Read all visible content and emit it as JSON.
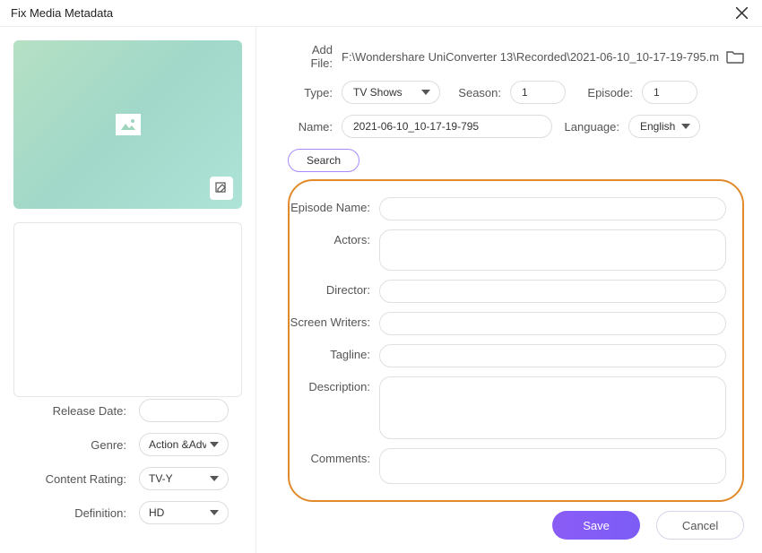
{
  "window": {
    "title": "Fix Media Metadata"
  },
  "left": {
    "releaseDateLabel": "Release Date:",
    "releaseDateValue": "",
    "genreLabel": "Genre:",
    "genreValue": "Action &Adv",
    "contentRatingLabel": "Content Rating:",
    "contentRatingValue": "TV-Y",
    "definitionLabel": "Definition:",
    "definitionValue": "HD"
  },
  "right": {
    "addFileLabel": "Add File:",
    "addFilePath": "F:\\Wondershare UniConverter 13\\Recorded\\2021-06-10_10-17-19-795.m",
    "typeLabel": "Type:",
    "typeValue": "TV Shows",
    "seasonLabel": "Season:",
    "seasonValue": "1",
    "episodeLabel": "Episode:",
    "episodeValue": "1",
    "nameLabel": "Name:",
    "nameValue": "2021-06-10_10-17-19-795",
    "languageLabel": "Language:",
    "languageValue": "English",
    "searchLabel": "Search"
  },
  "details": {
    "episodeNameLabel": "Episode Name:",
    "episodeNameValue": "",
    "actorsLabel": "Actors:",
    "actorsValue": "",
    "directorLabel": "Director:",
    "directorValue": "",
    "screenWritersLabel": "Screen Writers:",
    "screenWritersValue": "",
    "taglineLabel": "Tagline:",
    "taglineValue": "",
    "descriptionLabel": "Description:",
    "descriptionValue": "",
    "commentsLabel": "Comments:",
    "commentsValue": ""
  },
  "buttons": {
    "save": "Save",
    "cancel": "Cancel"
  }
}
